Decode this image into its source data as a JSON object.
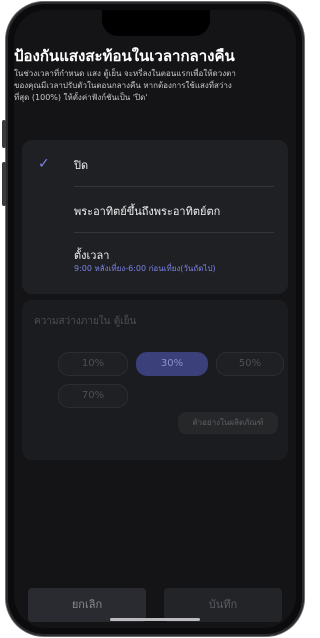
{
  "header": {
    "title": "ป้องกันแสงสะท้อนในเวลากลางคืน",
    "description_lines": [
      "ในช่วงเวลาที่กำหนด แสง ตู้เย็น จะหรี่ลงในตอนแรกเพื่อให้ดวงตา",
      "ของคุณมีเวลาปรับตัวในตอนกลางคืน หากต้องการใช้แสงที่สว่าง",
      "ที่สุด (100%) ให้ตั้งค่าฟังก์ชันเป็น 'ปิด'"
    ]
  },
  "options": [
    {
      "label": "ปิด",
      "selected": true
    },
    {
      "label": "พระอาทิตย์ขึ้นถึงพระอาทิตย์ตก",
      "selected": false
    },
    {
      "label": "ตั้งเวลา",
      "sub": "9:00 หลังเที่ยง-6:00 ก่อนเที่ยง(วันถัดไป)",
      "selected": false
    }
  ],
  "brightness": {
    "title": "ความสว่างภายใน ตู้เย็น",
    "levels": [
      "10%",
      "30%",
      "50%",
      "70%"
    ],
    "selected_level": "30%",
    "preview_label": "ตัวอย่างในผลิตภัณฑ์"
  },
  "footer": {
    "cancel_label": "ยกเลิก",
    "save_label": "บันทึก"
  },
  "colors": {
    "accent": "#7b83e6",
    "background": "#141416",
    "card": "#1f2023"
  }
}
